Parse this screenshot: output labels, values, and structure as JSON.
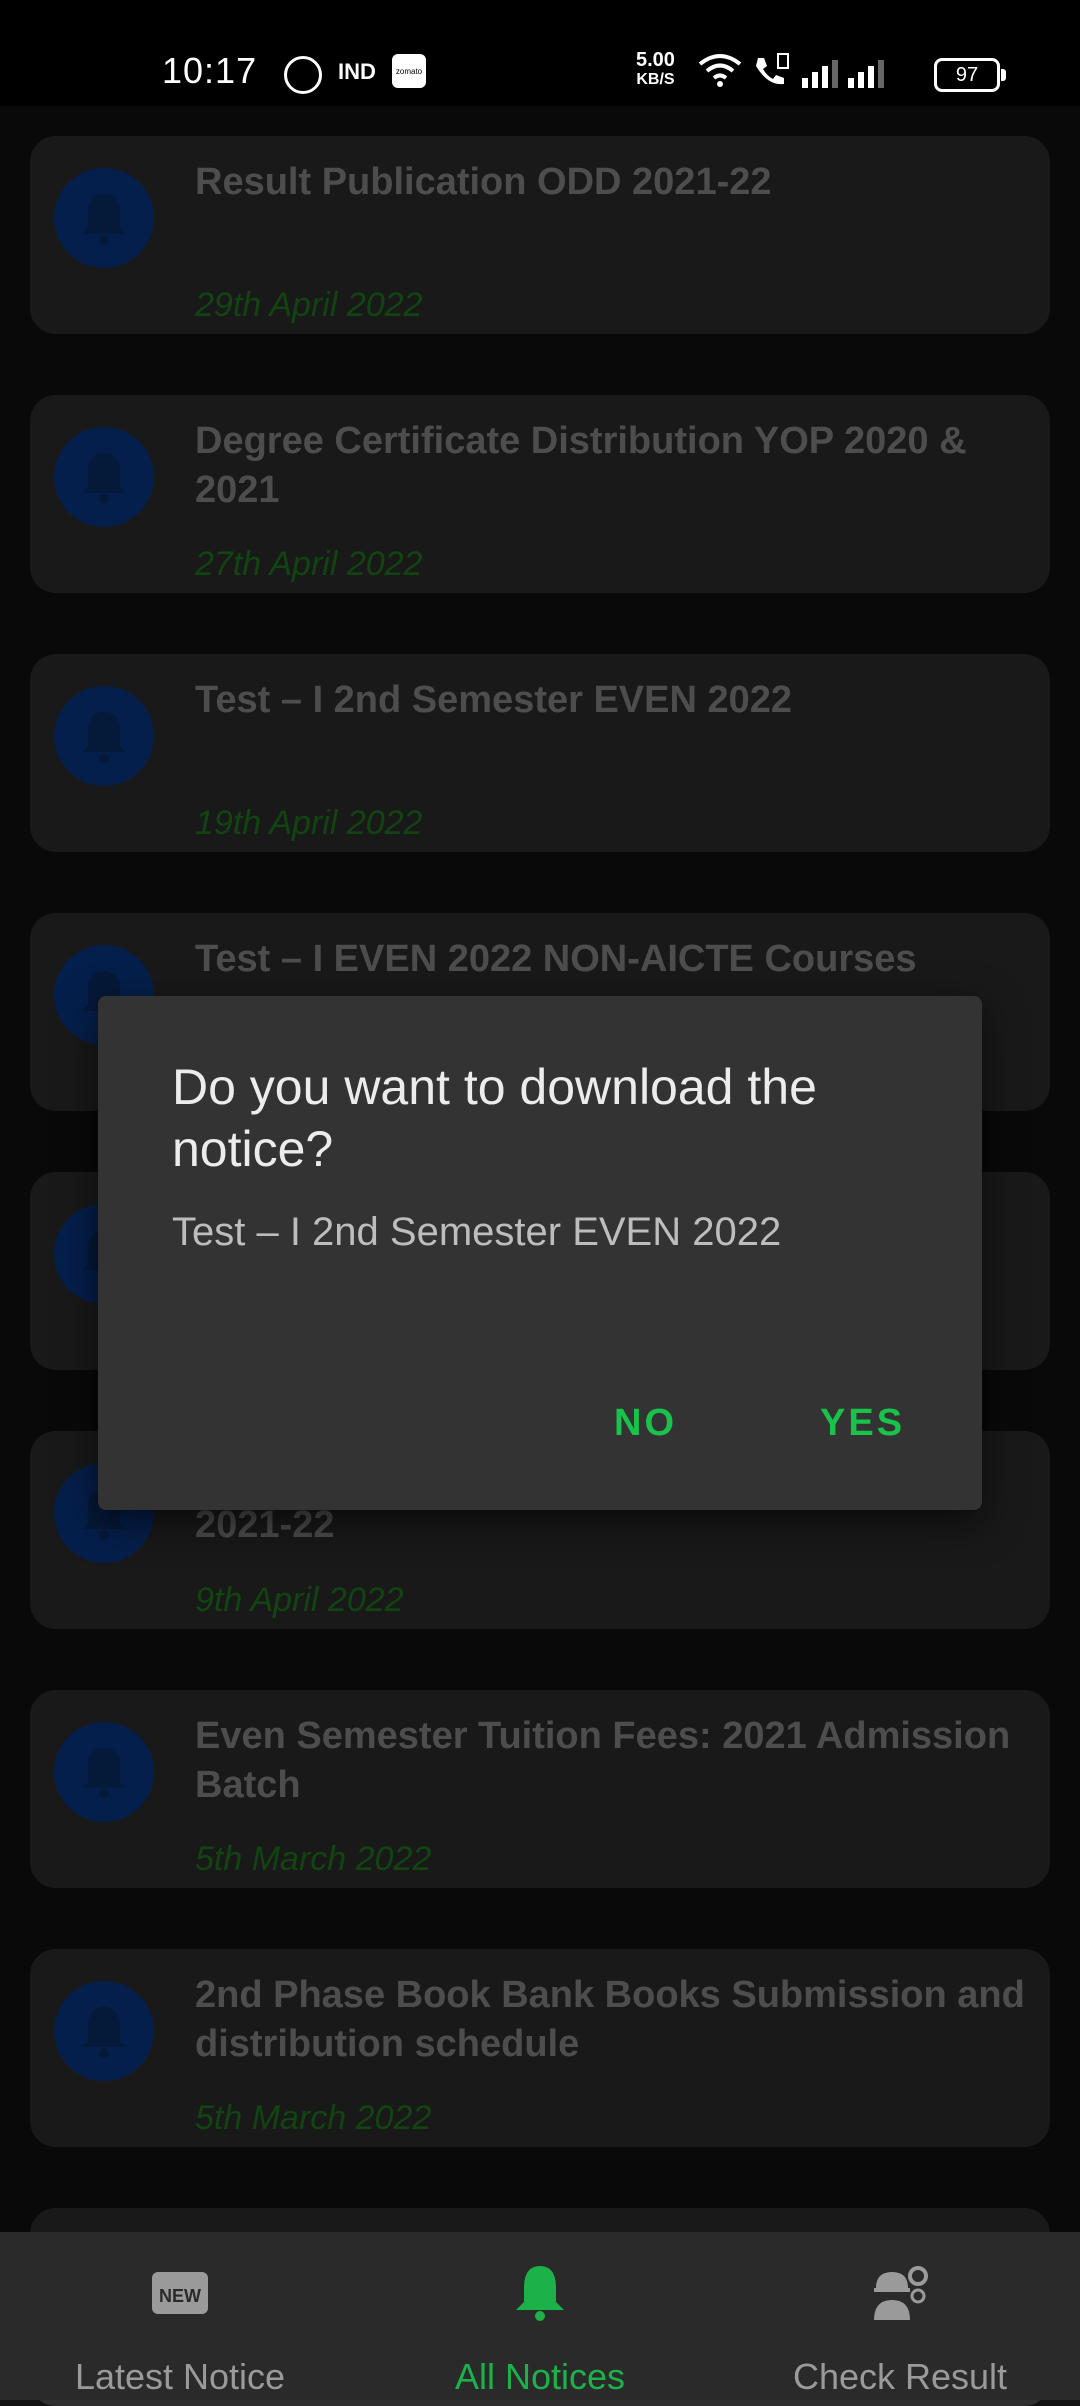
{
  "status_bar": {
    "time": "10:17",
    "ind_label": "IND",
    "zomato_label": "zomato",
    "net_speed": "5.00",
    "net_unit": "KB/S",
    "battery": "97"
  },
  "notices": [
    {
      "title": "Result Publication ODD 2021-22",
      "date": "29th April 2022"
    },
    {
      "title": "Degree Certificate Distribution YOP 2020 & 2021",
      "date": "27th April 2022"
    },
    {
      "title": "Test – I 2nd Semester EVEN 2022",
      "date": "19th April 2022"
    },
    {
      "title": "Test – I EVEN 2022 NON-AICTE Courses",
      "date": ""
    },
    {
      "title": "",
      "date": ""
    },
    {
      "title": "2021-22",
      "date": "9th April 2022"
    },
    {
      "title": "Even Semester Tuition Fees: 2021 Admission Batch",
      "date": "5th March 2022"
    },
    {
      "title": "2nd Phase Book Bank Books Submission and distribution schedule",
      "date": "5th March 2022"
    }
  ],
  "dialog": {
    "title": "Do you want to download the notice?",
    "message": "Test – I 2nd Semester EVEN 2022",
    "no_label": "NO",
    "yes_label": "YES"
  },
  "bottom_nav": {
    "items": [
      {
        "label": "Latest Notice",
        "icon": "new-badge-icon",
        "active": false
      },
      {
        "label": "All Notices",
        "icon": "bell-icon",
        "active": true
      },
      {
        "label": "Check Result",
        "icon": "worker-gear-icon",
        "active": false
      }
    ]
  },
  "colors": {
    "accent_green": "#19c24a",
    "date_green": "#1f7d1f",
    "bell_blue": "#0a3a8a",
    "card_bg": "#2f2f2f"
  }
}
